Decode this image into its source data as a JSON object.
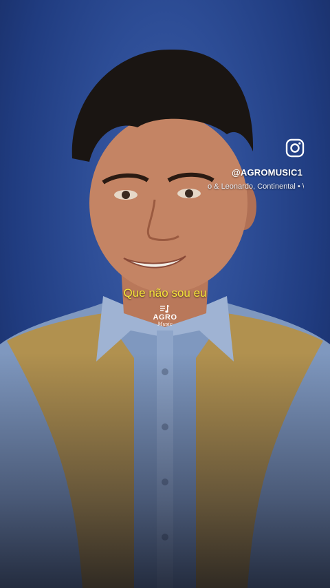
{
  "overlay": {
    "instagram_handle": "@AGROMUSIC1",
    "song_credit": "o & Leonardo, Continental • \\",
    "lyric": "Que não sou eu"
  },
  "logo": {
    "title": "AGRO",
    "subtitle": "Music"
  },
  "icons": {
    "social": "instagram-icon",
    "logo_glyph": "music-notes-icon"
  },
  "colors": {
    "background": "#2d4d96",
    "lyric": "#f5e43a",
    "text": "#ffffff"
  }
}
